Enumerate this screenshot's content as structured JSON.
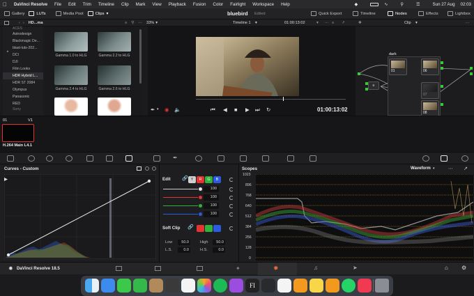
{
  "menubar": {
    "app": "DaVinci Resolve",
    "items": [
      "File",
      "Edit",
      "Trim",
      "Timeline",
      "Clip",
      "Mark",
      "View",
      "Playback",
      "Fusion",
      "Color",
      "Fairlight",
      "Workspace",
      "Help"
    ],
    "date": "Sun 27 Aug",
    "time": "02:03"
  },
  "toolbar": {
    "gallery": "Gallery",
    "luts": "LUTs",
    "media_pool": "Media Pool",
    "clips": "Clips",
    "project_title": "bluebird",
    "status": "Edited",
    "quick_export": "Quick Export",
    "timeline": "Timeline",
    "nodes": "Nodes",
    "effects": "Effects",
    "lightbox": "Lightbox"
  },
  "subbar": {
    "folder": "HD...ma",
    "zoom": "33%",
    "timeline_name": "Timeline 1",
    "timecode": "01:00:13:02",
    "clip_mode": "Clip"
  },
  "lut_folders": [
    "ACES",
    "Astrodesign",
    "Blackmagic De...",
    "blast-luts-202...",
    "DCI",
    "DJI",
    "Film Looks",
    "HDR Hybrid L...",
    "HDR ST 2084",
    "Olympus",
    "Panasonic",
    "RED",
    "Sony"
  ],
  "selected_folder": "HDR Hybrid L...",
  "lut_thumbs": [
    "Gamma 1.0 to HLG",
    "Gamma 2.2 to HLG",
    "Gamma 2.4 to HLG",
    "Gamma 2.6 to HLG",
    "",
    ""
  ],
  "viewer": {
    "timecode": "01:00:13:02"
  },
  "nodes": {
    "group_label": "dark",
    "labels": [
      "01",
      "06",
      "07",
      "08"
    ]
  },
  "clip": {
    "number": "01",
    "track": "V1",
    "codec": "H.264 Main L4.1"
  },
  "curves": {
    "title": "Curves - Custom"
  },
  "edit": {
    "title": "Edit",
    "values": [
      "100",
      "100",
      "100",
      "100"
    ],
    "y_letter": "Y",
    "r_letter": "R",
    "g_letter": "G",
    "b_letter": "B",
    "soft_clip": "Soft Clip",
    "low_label": "Low",
    "low_value": "50.0",
    "high_label": "High",
    "high_value": "50.0",
    "ls_label": "L.S.",
    "ls_value": "0.0",
    "hs_label": "H.S.",
    "hs_value": "0.0"
  },
  "scopes": {
    "title": "Scopes",
    "mode": "Waveform",
    "scale": [
      "1023",
      "896",
      "768",
      "640",
      "512",
      "384",
      "256",
      "128",
      "0"
    ]
  },
  "bottom": {
    "app_name": "DaVinci Resolve 18.5"
  },
  "colors": {
    "accent_red": "#e5342f",
    "node_green": "#3bc83b",
    "curve_white": "#e8e8e8"
  }
}
